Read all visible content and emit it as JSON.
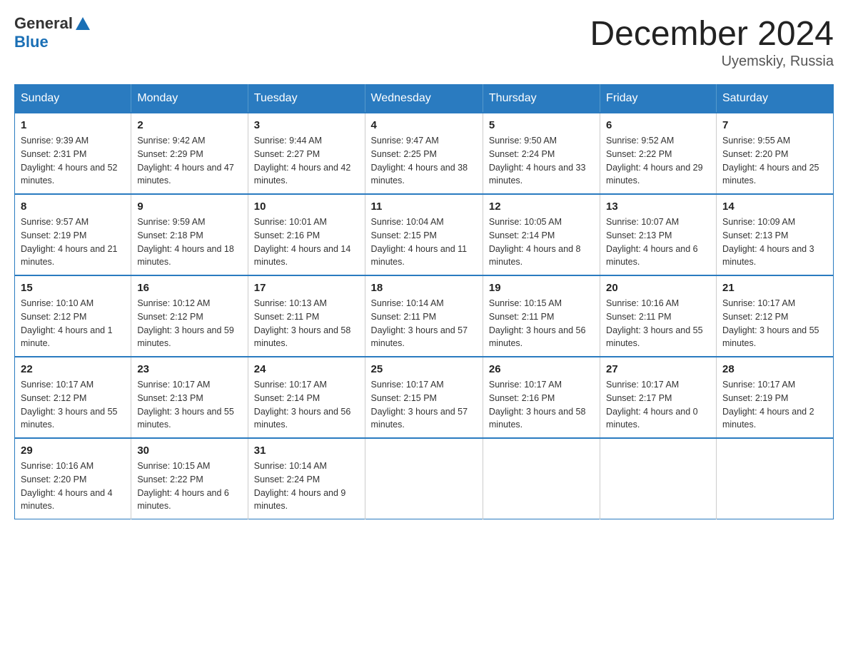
{
  "logo": {
    "general": "General",
    "blue": "Blue"
  },
  "header": {
    "month": "December 2024",
    "location": "Uyemskiy, Russia"
  },
  "days_of_week": [
    "Sunday",
    "Monday",
    "Tuesday",
    "Wednesday",
    "Thursday",
    "Friday",
    "Saturday"
  ],
  "weeks": [
    [
      {
        "day": "1",
        "sunrise": "9:39 AM",
        "sunset": "2:31 PM",
        "daylight": "4 hours and 52 minutes."
      },
      {
        "day": "2",
        "sunrise": "9:42 AM",
        "sunset": "2:29 PM",
        "daylight": "4 hours and 47 minutes."
      },
      {
        "day": "3",
        "sunrise": "9:44 AM",
        "sunset": "2:27 PM",
        "daylight": "4 hours and 42 minutes."
      },
      {
        "day": "4",
        "sunrise": "9:47 AM",
        "sunset": "2:25 PM",
        "daylight": "4 hours and 38 minutes."
      },
      {
        "day": "5",
        "sunrise": "9:50 AM",
        "sunset": "2:24 PM",
        "daylight": "4 hours and 33 minutes."
      },
      {
        "day": "6",
        "sunrise": "9:52 AM",
        "sunset": "2:22 PM",
        "daylight": "4 hours and 29 minutes."
      },
      {
        "day": "7",
        "sunrise": "9:55 AM",
        "sunset": "2:20 PM",
        "daylight": "4 hours and 25 minutes."
      }
    ],
    [
      {
        "day": "8",
        "sunrise": "9:57 AM",
        "sunset": "2:19 PM",
        "daylight": "4 hours and 21 minutes."
      },
      {
        "day": "9",
        "sunrise": "9:59 AM",
        "sunset": "2:18 PM",
        "daylight": "4 hours and 18 minutes."
      },
      {
        "day": "10",
        "sunrise": "10:01 AM",
        "sunset": "2:16 PM",
        "daylight": "4 hours and 14 minutes."
      },
      {
        "day": "11",
        "sunrise": "10:04 AM",
        "sunset": "2:15 PM",
        "daylight": "4 hours and 11 minutes."
      },
      {
        "day": "12",
        "sunrise": "10:05 AM",
        "sunset": "2:14 PM",
        "daylight": "4 hours and 8 minutes."
      },
      {
        "day": "13",
        "sunrise": "10:07 AM",
        "sunset": "2:13 PM",
        "daylight": "4 hours and 6 minutes."
      },
      {
        "day": "14",
        "sunrise": "10:09 AM",
        "sunset": "2:13 PM",
        "daylight": "4 hours and 3 minutes."
      }
    ],
    [
      {
        "day": "15",
        "sunrise": "10:10 AM",
        "sunset": "2:12 PM",
        "daylight": "4 hours and 1 minute."
      },
      {
        "day": "16",
        "sunrise": "10:12 AM",
        "sunset": "2:12 PM",
        "daylight": "3 hours and 59 minutes."
      },
      {
        "day": "17",
        "sunrise": "10:13 AM",
        "sunset": "2:11 PM",
        "daylight": "3 hours and 58 minutes."
      },
      {
        "day": "18",
        "sunrise": "10:14 AM",
        "sunset": "2:11 PM",
        "daylight": "3 hours and 57 minutes."
      },
      {
        "day": "19",
        "sunrise": "10:15 AM",
        "sunset": "2:11 PM",
        "daylight": "3 hours and 56 minutes."
      },
      {
        "day": "20",
        "sunrise": "10:16 AM",
        "sunset": "2:11 PM",
        "daylight": "3 hours and 55 minutes."
      },
      {
        "day": "21",
        "sunrise": "10:17 AM",
        "sunset": "2:12 PM",
        "daylight": "3 hours and 55 minutes."
      }
    ],
    [
      {
        "day": "22",
        "sunrise": "10:17 AM",
        "sunset": "2:12 PM",
        "daylight": "3 hours and 55 minutes."
      },
      {
        "day": "23",
        "sunrise": "10:17 AM",
        "sunset": "2:13 PM",
        "daylight": "3 hours and 55 minutes."
      },
      {
        "day": "24",
        "sunrise": "10:17 AM",
        "sunset": "2:14 PM",
        "daylight": "3 hours and 56 minutes."
      },
      {
        "day": "25",
        "sunrise": "10:17 AM",
        "sunset": "2:15 PM",
        "daylight": "3 hours and 57 minutes."
      },
      {
        "day": "26",
        "sunrise": "10:17 AM",
        "sunset": "2:16 PM",
        "daylight": "3 hours and 58 minutes."
      },
      {
        "day": "27",
        "sunrise": "10:17 AM",
        "sunset": "2:17 PM",
        "daylight": "4 hours and 0 minutes."
      },
      {
        "day": "28",
        "sunrise": "10:17 AM",
        "sunset": "2:19 PM",
        "daylight": "4 hours and 2 minutes."
      }
    ],
    [
      {
        "day": "29",
        "sunrise": "10:16 AM",
        "sunset": "2:20 PM",
        "daylight": "4 hours and 4 minutes."
      },
      {
        "day": "30",
        "sunrise": "10:15 AM",
        "sunset": "2:22 PM",
        "daylight": "4 hours and 6 minutes."
      },
      {
        "day": "31",
        "sunrise": "10:14 AM",
        "sunset": "2:24 PM",
        "daylight": "4 hours and 9 minutes."
      },
      null,
      null,
      null,
      null
    ]
  ]
}
